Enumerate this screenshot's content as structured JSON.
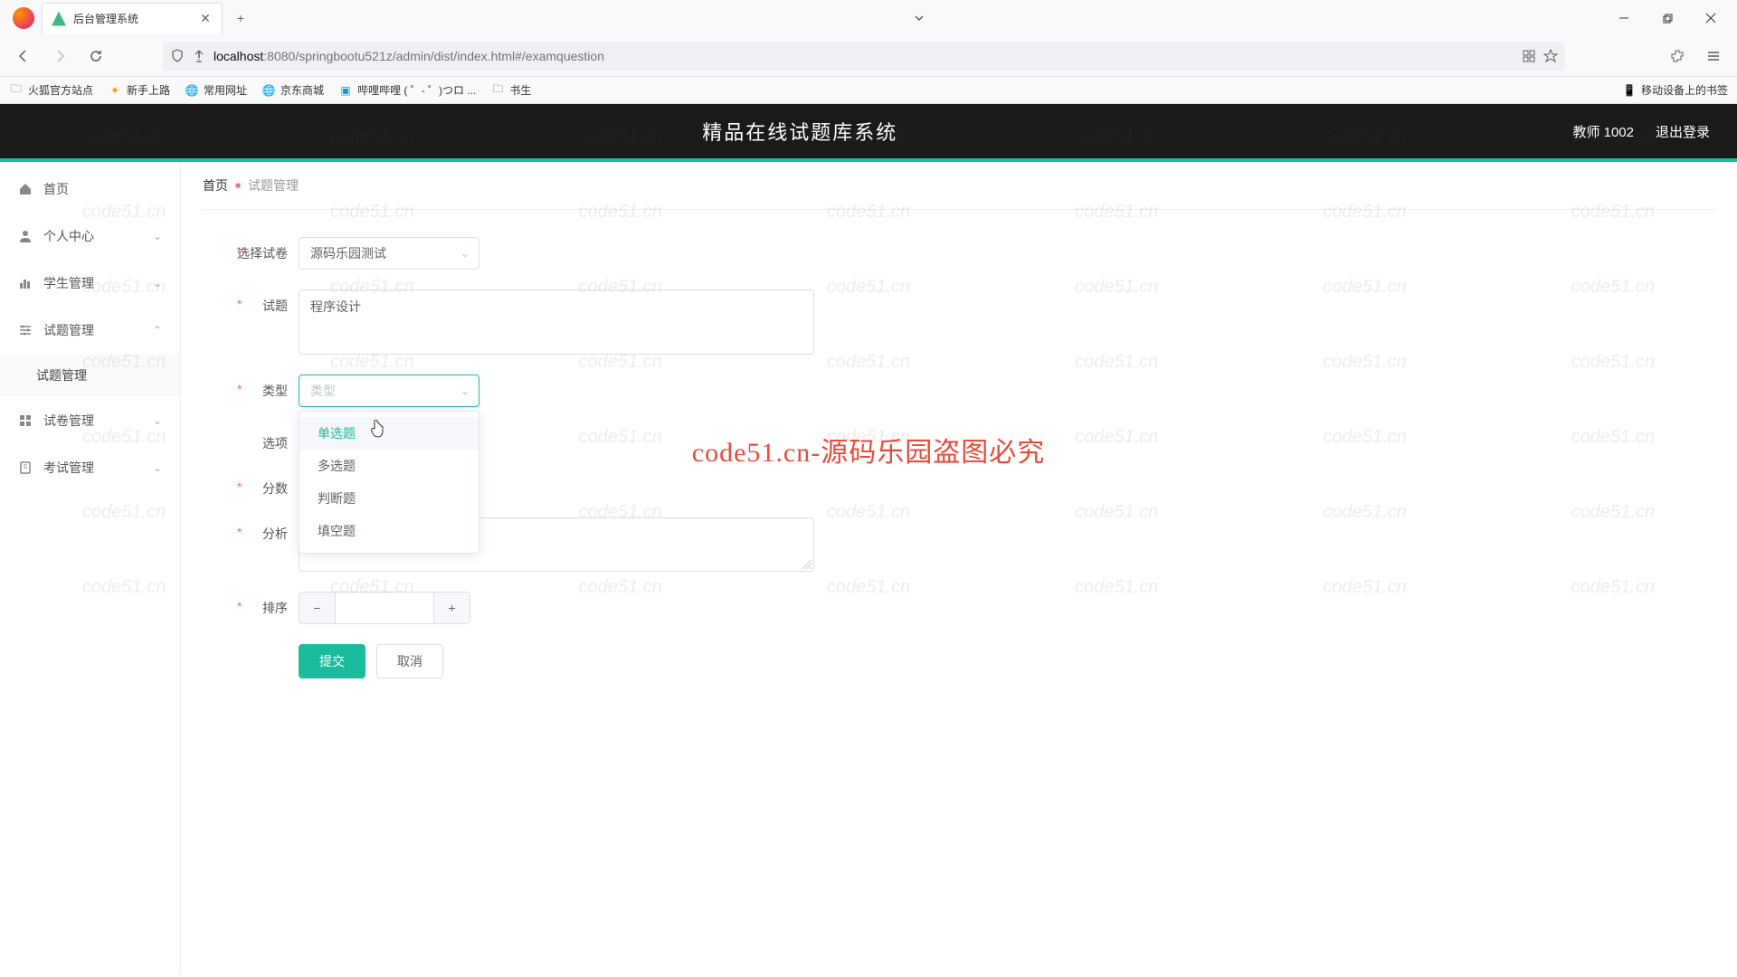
{
  "browser": {
    "tab_title": "后台管理系统",
    "url_host": "localhost",
    "url_port": ":8080",
    "url_path": "/springbootu521z/admin/dist/index.html#/examquestion",
    "bookmarks": [
      "火狐官方站点",
      "新手上路",
      "常用网址",
      "京东商城",
      "哔哩哔哩 ( ゜- ゜)つロ ...",
      "书生"
    ],
    "mobile_bookmarks": "移动设备上的书签"
  },
  "header": {
    "title": "精品在线试题库系统",
    "user": "教师 1002",
    "logout": "退出登录"
  },
  "sidebar": {
    "items": [
      {
        "label": "首页",
        "icon": "home"
      },
      {
        "label": "个人中心",
        "icon": "user",
        "arrow": "down"
      },
      {
        "label": "学生管理",
        "icon": "chart",
        "arrow": "down"
      },
      {
        "label": "试题管理",
        "icon": "sliders",
        "arrow": "up"
      },
      {
        "label": "试卷管理",
        "icon": "grid",
        "arrow": "down"
      },
      {
        "label": "考试管理",
        "icon": "book",
        "arrow": "down"
      }
    ],
    "sub_item": "试题管理"
  },
  "breadcrumb": {
    "home": "首页",
    "current": "试题管理"
  },
  "form": {
    "select_paper_label": "选择试卷",
    "select_paper_value": "源码乐园测试",
    "question_label": "试题",
    "question_value": "程序设计",
    "type_label": "类型",
    "type_placeholder": "类型",
    "type_options": [
      "单选题",
      "多选题",
      "判断题",
      "填空题"
    ],
    "options_label": "选项",
    "score_label": "分数",
    "analysis_label": "分析",
    "analysis_placeholder": "分析",
    "sort_label": "排序",
    "submit": "提交",
    "cancel": "取消"
  },
  "watermark": {
    "text": "code51.cn",
    "center": "code51.cn-源码乐园盗图必究"
  }
}
